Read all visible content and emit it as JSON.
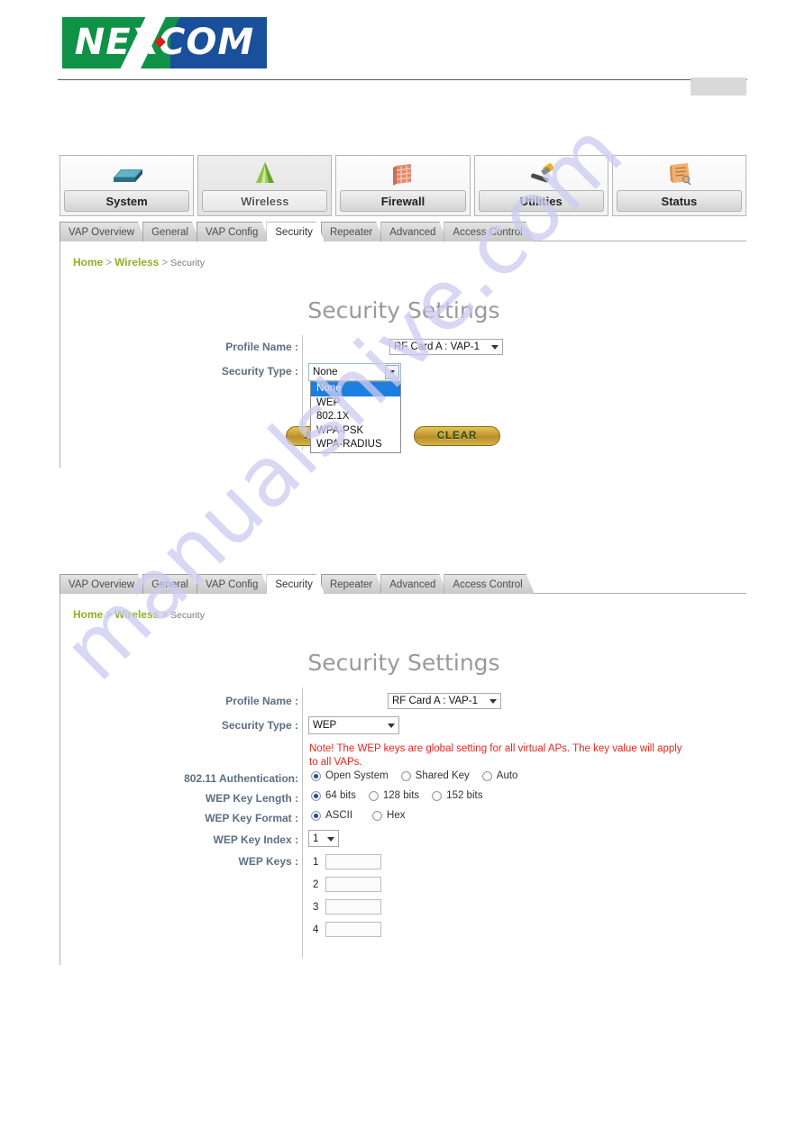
{
  "brand": {
    "logo_text": "NEXCOM"
  },
  "mainnav": [
    {
      "label": "System",
      "icon": "router-device-icon",
      "active": false
    },
    {
      "label": "Wireless",
      "icon": "green-pyramid-icon",
      "active": true
    },
    {
      "label": "Firewall",
      "icon": "brick-wall-icon",
      "active": false
    },
    {
      "label": "Utilities",
      "icon": "hammer-icon",
      "active": false
    },
    {
      "label": "Status",
      "icon": "clipboard-icon",
      "active": false
    }
  ],
  "tabs": [
    {
      "label": "VAP Overview",
      "active": false
    },
    {
      "label": "General",
      "active": false
    },
    {
      "label": "VAP Config",
      "active": false
    },
    {
      "label": "Security",
      "active": true
    },
    {
      "label": "Repeater",
      "active": false
    },
    {
      "label": "Advanced",
      "active": false
    },
    {
      "label": "Access Control",
      "active": false
    }
  ],
  "breadcrumb": {
    "home": "Home",
    "section": "Wireless",
    "current": "Security",
    "sep": ">"
  },
  "panel_none": {
    "title": "Security Settings",
    "profile_label": "Profile Name :",
    "profile_value": "RF Card A : VAP-1",
    "security_label": "Security Type :",
    "security_value": "None",
    "options": [
      "None",
      "WEP",
      "802.1X",
      "WPA-PSK",
      "WPA-RADIUS"
    ],
    "selected_option": "None",
    "apply_button": "APPLY",
    "clear_button": "CLEAR"
  },
  "panel_wep": {
    "title": "Security Settings",
    "profile_label": "Profile Name :",
    "profile_value": "RF Card A : VAP-1",
    "security_label": "Security Type :",
    "security_value": "WEP",
    "note": "Note! The WEP keys are global setting for all virtual APs. The key value will apply to all VAPs.",
    "auth_label": "802.11 Authentication:",
    "auth_options": [
      {
        "label": "Open System",
        "checked": true
      },
      {
        "label": "Shared Key",
        "checked": false
      },
      {
        "label": "Auto",
        "checked": false
      }
    ],
    "keylen_label": "WEP Key Length :",
    "keylen_options": [
      {
        "label": "64 bits",
        "checked": true
      },
      {
        "label": "128 bits",
        "checked": false
      },
      {
        "label": "152 bits",
        "checked": false
      }
    ],
    "keyfmt_label": "WEP Key Format :",
    "keyfmt_options": [
      {
        "label": "ASCII",
        "checked": true
      },
      {
        "label": "Hex",
        "checked": false
      }
    ],
    "keyindex_label": "WEP Key Index :",
    "keyindex_value": "1",
    "keys_label": "WEP Keys :",
    "keys": [
      {
        "num": "1",
        "value": ""
      },
      {
        "num": "2",
        "value": ""
      },
      {
        "num": "3",
        "value": ""
      },
      {
        "num": "4",
        "value": ""
      }
    ]
  },
  "watermark": {
    "text": "manualshive.com"
  },
  "colors": {
    "logo_green": "#0f9246",
    "logo_blue": "#1a4f9c",
    "logo_red": "#d91d1d",
    "crumb_link": "#8fb024",
    "label_blue": "#5b6f85",
    "note_red": "#e8241b",
    "gold_button": "#c79a2e",
    "dropdown_highlight": "#1c7fe0"
  }
}
